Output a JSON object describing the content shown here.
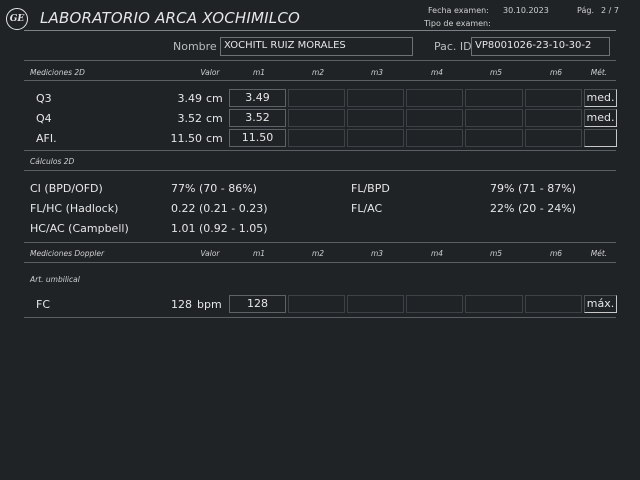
{
  "header": {
    "title": "LABORATORIO ARCA XOCHIMILCO",
    "fecha_label": "Fecha examen:",
    "fecha_value": "30.10.2023",
    "pag_label": "Pág.",
    "pag_value": "2 / 7",
    "tipo_label": "Tipo de examen:",
    "tipo_value": ""
  },
  "patient": {
    "name_label": "Nombre",
    "name_value": "XOCHITL RUIZ MORALES",
    "id_label": "Pac. ID",
    "id_value": "VP8001026-23-10-30-2"
  },
  "columns": {
    "valor": "Valor",
    "m1": "m1",
    "m2": "m2",
    "m3": "m3",
    "m4": "m4",
    "m5": "m5",
    "m6": "m6",
    "met": "Mét."
  },
  "mediciones2d": {
    "section": "Mediciones 2D",
    "rows": [
      {
        "label": "Q3",
        "value": "3.49",
        "unit": "cm",
        "m1": "3.49",
        "method": "med."
      },
      {
        "label": "Q4",
        "value": "3.52",
        "unit": "cm",
        "m1": "3.52",
        "method": "med."
      },
      {
        "label": "AFI.",
        "value": "11.50",
        "unit": "cm",
        "m1": "11.50",
        "method": ""
      }
    ]
  },
  "calculos2d": {
    "section": "Cálculos 2D",
    "items": [
      {
        "label": "CI (BPD/OFD)",
        "value": "77% (70 - 86%)"
      },
      {
        "label": "FL/HC (Hadlock)",
        "value": "0.22 (0.21 - 0.23)"
      },
      {
        "label": "HC/AC (Campbell)",
        "value": "1.01 (0.92 - 1.05)"
      },
      {
        "label": "FL/BPD",
        "value": "79% (71 - 87%)"
      },
      {
        "label": "FL/AC",
        "value": "22% (20 - 24%)"
      }
    ]
  },
  "doppler": {
    "section": "Mediciones Doppler",
    "subsection": "Art. umbilical",
    "rows": [
      {
        "label": "FC",
        "value": "128",
        "unit": "bpm",
        "m1": "128",
        "method": "máx."
      }
    ]
  },
  "logo_icon": "ge-logo-icon"
}
